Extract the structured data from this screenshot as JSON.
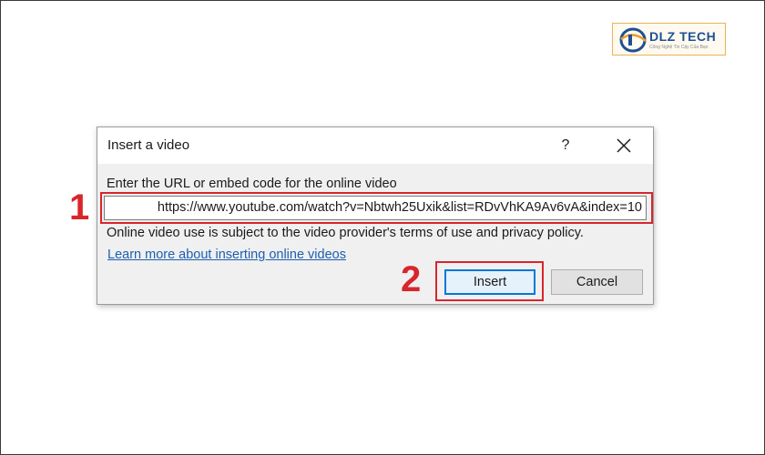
{
  "watermark": {
    "brand": "DLZ TECH",
    "tagline": "Công Nghệ Tin Cậy Của Bạn"
  },
  "dialog": {
    "title": "Insert a video",
    "help_label": "?",
    "prompt": "Enter the URL or embed code for the online video",
    "url_value": "https://www.youtube.com/watch?v=Nbtwh25Uxik&list=RDvVhKA9Av6vA&index=10",
    "policy_text": "Online video use is subject to the video provider's terms of use and privacy policy.",
    "learn_more_link": "Learn more about inserting online videos",
    "insert_label": "Insert",
    "cancel_label": "Cancel"
  },
  "annotations": {
    "step1": "1",
    "step2": "2"
  },
  "colors": {
    "annotation_red": "#d8262b",
    "link_blue": "#1e5fb0",
    "primary_button_border": "#0078d7"
  },
  "icons": {
    "close": "close-icon",
    "logo": "dlz-logo-icon"
  }
}
